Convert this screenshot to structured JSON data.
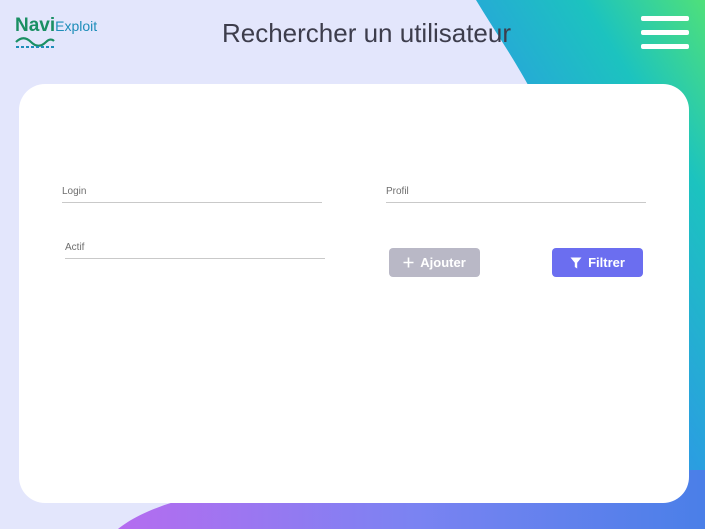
{
  "app": {
    "logo_primary": "Navi",
    "logo_secondary": "Exploit",
    "title": "Rechercher un utilisateur",
    "menu_icon": "hamburger-menu-icon"
  },
  "form": {
    "login": {
      "placeholder": "Login",
      "value": ""
    },
    "profil": {
      "placeholder": "Profil",
      "value": ""
    },
    "actif": {
      "placeholder": "Actif",
      "value": ""
    }
  },
  "actions": {
    "add": {
      "label": "Ajouter",
      "icon": "plus-icon",
      "color": "#b9b8c6"
    },
    "filter": {
      "label": "Filtrer",
      "icon": "filter-funnel-icon",
      "color": "#6b6ef0"
    }
  },
  "colors": {
    "page_background": "#e3e6fc",
    "gradient_green": "#4fe07a",
    "gradient_teal": "#1ab8c8",
    "gradient_blue": "#4a7fe8",
    "gradient_purple": "#b56cf0",
    "title_text": "#3d3d4c"
  }
}
